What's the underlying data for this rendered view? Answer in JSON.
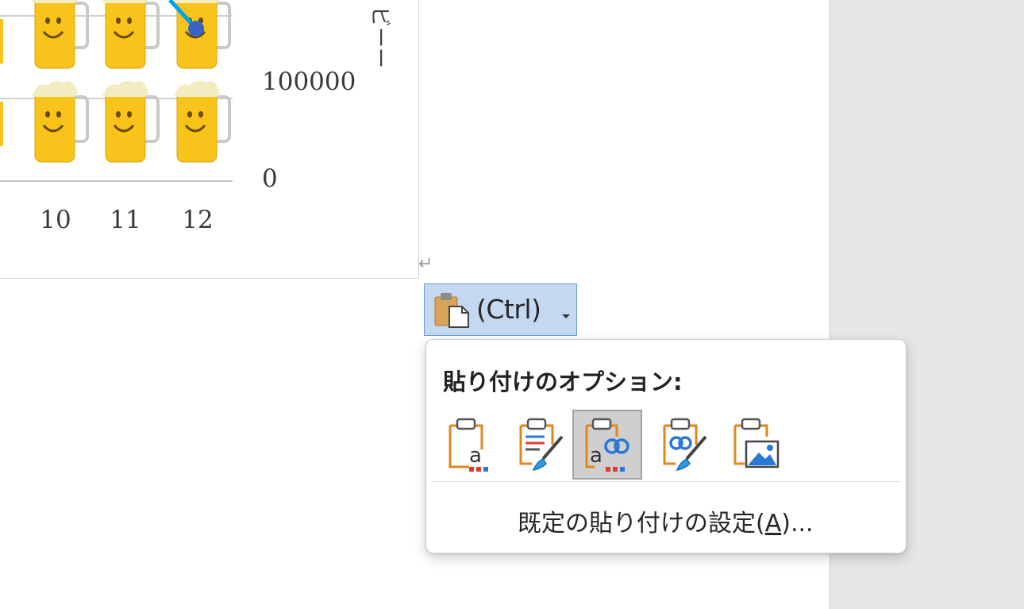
{
  "chart": {
    "x_tick_labels": [
      "10",
      "11",
      "12"
    ],
    "y_tick_labels": [
      "100000",
      "0"
    ],
    "y_axis_title_fragment": "ビーー"
  },
  "paragraph_mark": "↵",
  "paste_button": {
    "label": "(Ctrl)",
    "icon": "clipboard-paste-icon",
    "arrow": "dropdown-arrow-icon"
  },
  "paste_menu": {
    "heading": "貼り付けのオプション:",
    "options": [
      {
        "icon": "keep-source-formatting-icon",
        "selected": false
      },
      {
        "icon": "merge-formatting-icon",
        "selected": false
      },
      {
        "icon": "keep-text-only-link-icon",
        "selected": true
      },
      {
        "icon": "link-brush-icon",
        "selected": false
      },
      {
        "icon": "picture-icon",
        "selected": false
      }
    ],
    "default_settings": {
      "before": "既定の貼り付けの設定(",
      "accel": "A",
      "after": ")..."
    }
  },
  "colors": {
    "selection_blue": "#c5d8f1",
    "selection_border": "#6a9ad6",
    "accent_orange": "#e2861b",
    "line_cyan": "#00a2e8",
    "marker_blue": "#3b63c4",
    "mug_yellow": "#f8c31a"
  }
}
